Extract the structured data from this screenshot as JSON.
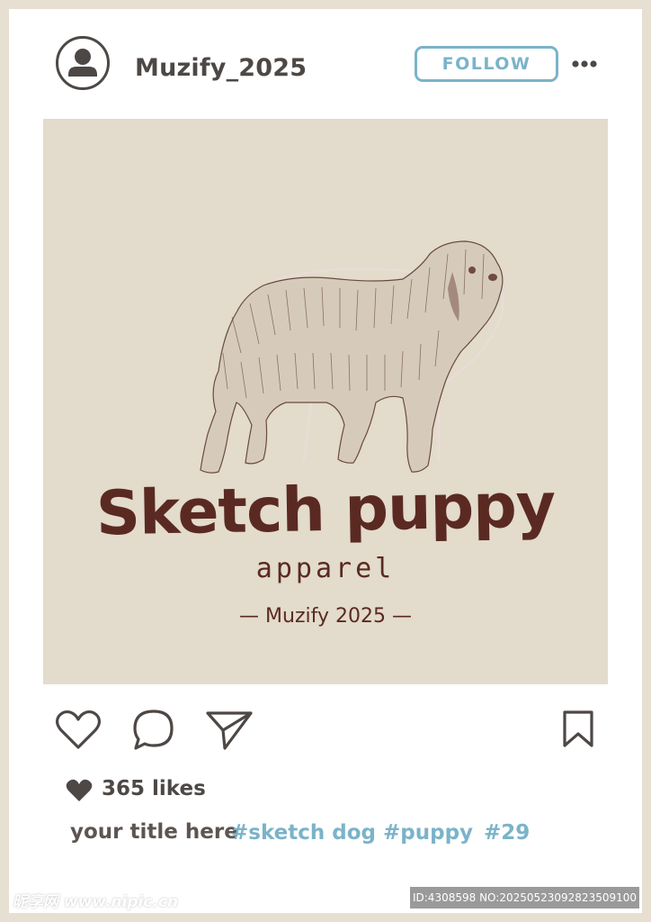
{
  "header": {
    "username": "Muzify_2025",
    "follow_label": "FOLLOW"
  },
  "post": {
    "brand_title": "Sketch puppy",
    "brand_subtitle": "apparel",
    "brand_credit": "— Muzify 2025 —"
  },
  "engagement": {
    "likes_text": "365 likes"
  },
  "caption": {
    "title": "your title here",
    "tags": [
      "#sketch dog",
      "#puppy",
      "#29"
    ]
  },
  "watermark": {
    "site": "昵享网 www.nipic.cn",
    "id_text": "ID:4308598 NO:20250523092823509100"
  },
  "colors": {
    "accent": "#7bb3c9",
    "text_dark": "#4d4845",
    "image_bg": "#e3dbcb",
    "brand_ink": "#5a2a22",
    "frame": "#e6dfd2"
  },
  "icons": [
    "user-icon",
    "more-icon",
    "heart-icon",
    "comment-icon",
    "share-icon",
    "bookmark-icon",
    "likes-heart-icon"
  ]
}
